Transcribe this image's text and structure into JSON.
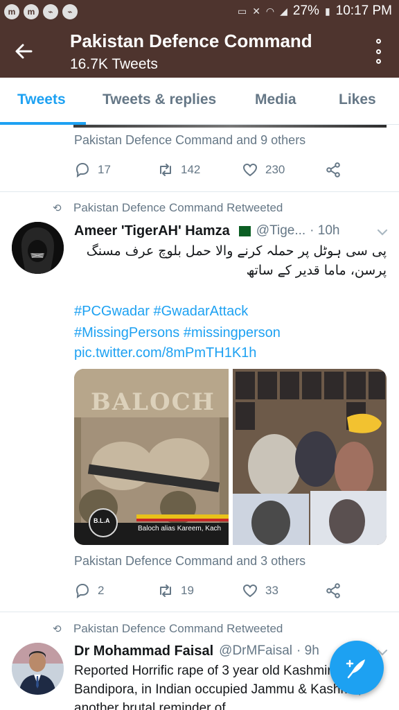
{
  "status_bar": {
    "battery": "27%",
    "time": "10:17 PM",
    "app_icons": [
      "m",
      "m",
      "messenger",
      "messenger"
    ]
  },
  "app_bar": {
    "title": "Pakistan Defence Command",
    "subtitle": "16.7K Tweets"
  },
  "tabs": [
    {
      "label": "Tweets",
      "active": true
    },
    {
      "label": "Tweets & replies",
      "active": false
    },
    {
      "label": "Media",
      "active": false
    },
    {
      "label": "Likes",
      "active": false
    }
  ],
  "feed": {
    "prev_tweet": {
      "liked_by": "Pakistan Defence Command and 9 others",
      "replies": "17",
      "retweets": "142",
      "likes": "230"
    },
    "tweet1": {
      "retweet_label": "Pakistan Defence Command Retweeted",
      "author_name": "Ameer 'TigerAH' Hamza",
      "handle": "@Tige...",
      "time": "· 10h",
      "text_urdu": "پی سی ہوٹل پر حملہ کرنے والا حمل بلوچ عرف مسنگ پرسن، ماما قدیر کے ساتھ",
      "hashtags_line1": "#PCGwadar #GwadarAttack",
      "hashtags_line2": "#MissingPersons #missingperson",
      "pic_link": "pic.twitter.com/8mPmTH1K1h",
      "image_left_banner": "BALOCH",
      "image_left_badge": "B.L.A",
      "image_left_caption": "Baloch alias Kareem, Kach",
      "liked_by": "Pakistan Defence Command and 3 others",
      "replies": "2",
      "retweets": "19",
      "likes": "33"
    },
    "tweet2": {
      "retweet_label": "Pakistan Defence Command Retweeted",
      "author_name": "Dr Mohammad Faisal",
      "handle": "@DrMFaisal",
      "time": "· 9h",
      "text": "Reported Horrific rape of 3 year old Kashmiri girl in Bandipora, in Indian occupied Jammu & Kashmir, another brutal reminder of"
    }
  },
  "colors": {
    "app_bar": "#4e342e",
    "accent": "#1da1f2",
    "muted": "#657786"
  }
}
